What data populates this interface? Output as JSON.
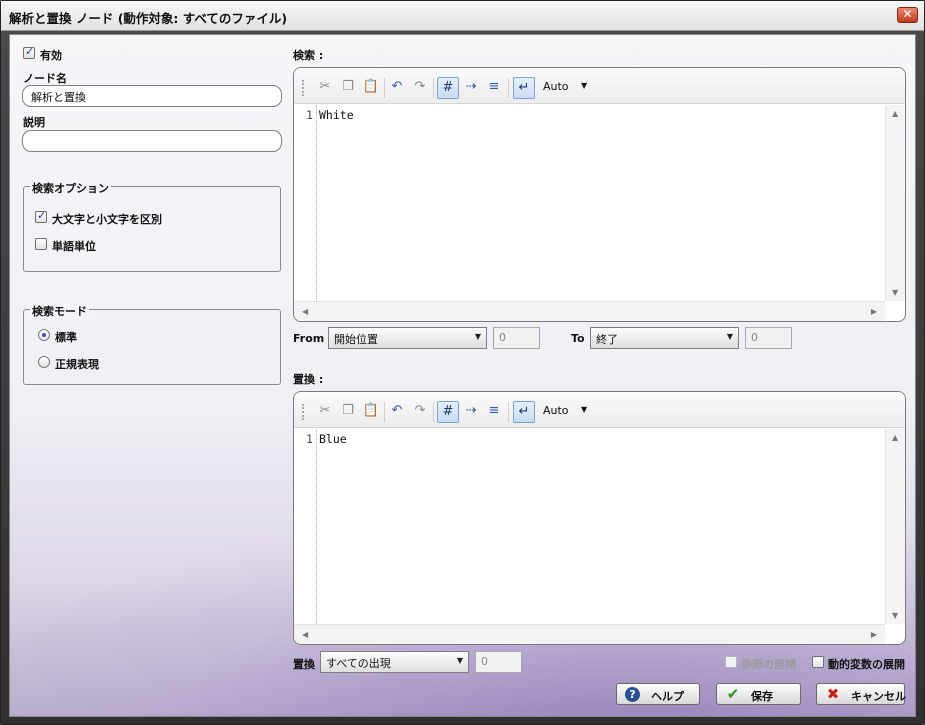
{
  "window": {
    "title": "解析と置換 ノード   (動作対象: すべてのファイル)"
  },
  "left": {
    "enabled_label": "有効",
    "node_name_label": "ノード名",
    "node_name_value": "解析と置換",
    "description_label": "説明",
    "description_value": "",
    "search_options": {
      "legend": "検索オプション",
      "case_sensitive": "大文字と小文字を区別",
      "whole_word": "単語単位"
    },
    "search_mode": {
      "legend": "検索モード",
      "standard": "標準",
      "regex": "正規表現"
    }
  },
  "search": {
    "label": "検索 :",
    "toolbar": {
      "mode": "Auto"
    },
    "line_number": "1",
    "content": "White"
  },
  "range": {
    "from_label": "From",
    "from_value": "開始位置",
    "from_number": "0",
    "to_label": "To",
    "to_value": "終了",
    "to_number": "0"
  },
  "replace": {
    "label": "置換 :",
    "toolbar": {
      "mode": "Auto"
    },
    "line_number": "1",
    "content": "Blue"
  },
  "bottom": {
    "replace_label": "置換",
    "replace_value": "すべての出現",
    "replace_number": "0",
    "expand_reference": "参照の展開",
    "expand_dynamic": "動的変数の展開"
  },
  "buttons": {
    "help": "ヘルプ",
    "save": "保存",
    "cancel": "キャンセル"
  }
}
